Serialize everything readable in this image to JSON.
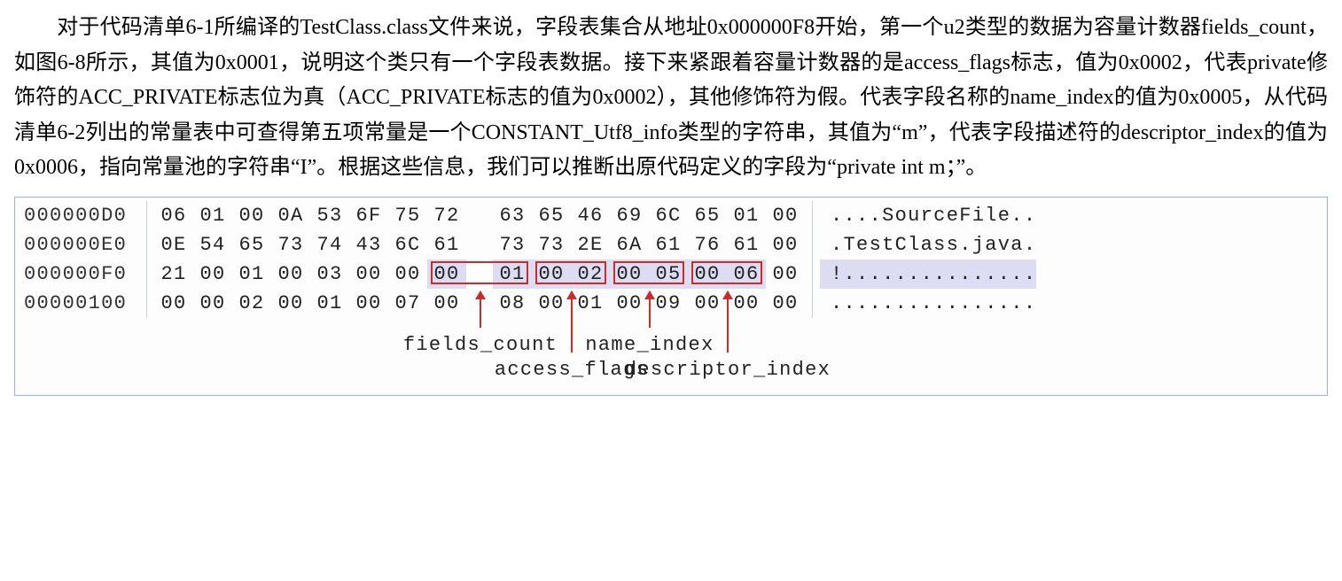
{
  "paragraph": "对于代码清单6-1所编译的TestClass.class文件来说，字段表集合从地址0x000000F8开始，第一个u2类型的数据为容量计数器fields_count，如图6-8所示，其值为0x0001，说明这个类只有一个字段表数据。接下来紧跟着容量计数器的是access_flags标志，值为0x0002，代表private修饰符的ACC_PRIVATE标志位为真（ACC_PRIVATE标志的值为0x0002），其他修饰符为假。代表字段名称的name_index的值为0x0005，从代码清单6-2列出的常量表中可查得第五项常量是一个CONSTANT_Utf8_info类型的字符串，其值为“m”，代表字段描述符的descriptor_index的值为0x0006，指向常量池的字符串“I”。根据这些信息，我们可以推断出原代码定义的字段为“private int m；”。",
  "hex": {
    "rows": [
      {
        "addr": "000000D0",
        "bytes": [
          "06",
          "01",
          "00",
          "0A",
          "53",
          "6F",
          "75",
          "72",
          "63",
          "65",
          "46",
          "69",
          "6C",
          "65",
          "01",
          "00"
        ],
        "ascii": "....SourceFile.."
      },
      {
        "addr": "000000E0",
        "bytes": [
          "0E",
          "54",
          "65",
          "73",
          "74",
          "43",
          "6C",
          "61",
          "73",
          "73",
          "2E",
          "6A",
          "61",
          "76",
          "61",
          "00"
        ],
        "ascii": ".TestClass.java."
      },
      {
        "addr": "000000F0",
        "bytes": [
          "21",
          "00",
          "01",
          "00",
          "03",
          "00",
          "00",
          "00",
          "01",
          "00",
          "02",
          "00",
          "05",
          "00",
          "06",
          "00"
        ],
        "ascii": "!...............",
        "highlight": [
          7,
          8,
          9,
          10,
          11,
          12,
          13,
          14
        ],
        "boxes": [
          [
            7,
            8
          ],
          [
            9,
            10
          ],
          [
            11,
            12
          ],
          [
            13,
            14
          ]
        ],
        "ascii_hl": true
      },
      {
        "addr": "00000100",
        "bytes": [
          "00",
          "00",
          "02",
          "00",
          "01",
          "00",
          "07",
          "00",
          "08",
          "00",
          "01",
          "00",
          "09",
          "00",
          "00",
          "00"
        ],
        "ascii": "................"
      }
    ],
    "labels": {
      "fields_count": "fields_count",
      "access_flags": "access_flags",
      "name_index": "name_index",
      "descriptor_index": "descriptor_index"
    }
  }
}
